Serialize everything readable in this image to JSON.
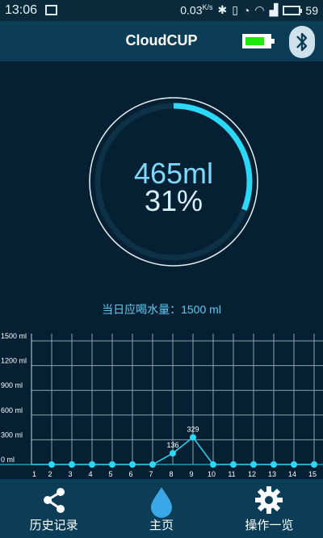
{
  "status_bar": {
    "time": "13:06",
    "network_speed": "0.03",
    "network_speed_unit": "K/s",
    "battery_level": "59"
  },
  "app": {
    "title": "CloudCUP",
    "device_battery_fraction": 0.82
  },
  "dial": {
    "amount": "465ml",
    "percent": "31%",
    "progress_fraction": 0.31
  },
  "daily_goal": {
    "text": "当日应喝水量：1500 ml"
  },
  "colors": {
    "accent": "#2bd9f6",
    "background": "#052033",
    "header": "#0b3e56",
    "battery_fill": "#22e80f"
  },
  "chart_data": {
    "type": "line",
    "x": [
      "1",
      "2",
      "3",
      "4",
      "5",
      "6",
      "7",
      "8",
      "9",
      "10",
      "11",
      "12",
      "13",
      "14",
      "15"
    ],
    "values": [
      0,
      0,
      0,
      0,
      0,
      0,
      0,
      136,
      329,
      0,
      0,
      0,
      0,
      0,
      0
    ],
    "y_ticks": [
      "0 ml",
      "300 ml",
      "600 ml",
      "900 ml",
      "1200 ml",
      "1500 ml"
    ],
    "ylim": [
      0,
      1500
    ],
    "data_labels": [
      {
        "x": "8",
        "label": "136"
      },
      {
        "x": "9",
        "label": "329"
      }
    ],
    "grid": true
  },
  "tabs": [
    {
      "label": "历史记录",
      "icon": "share-icon"
    },
    {
      "label": "主页",
      "icon": "water-drop-icon"
    },
    {
      "label": "操作一览",
      "icon": "gear-icon"
    }
  ]
}
